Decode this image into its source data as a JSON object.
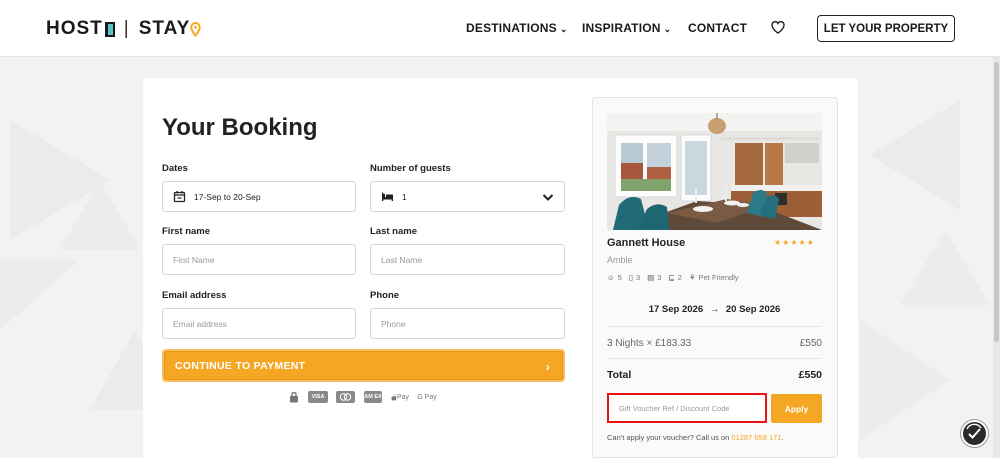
{
  "header": {
    "logo_host": "HOST",
    "logo_stay": "STAY",
    "nav_destinations": "DESTINATIONS",
    "nav_inspiration": "INSPIRATION",
    "nav_contact": "CONTACT",
    "let_property": "LET YOUR PROPERTY",
    "icons": [
      "heart-icon",
      "chevron-down-icon",
      "map-pin-icon"
    ]
  },
  "booking": {
    "title": "Your Booking",
    "dates_label": "Dates",
    "dates_value": "17-Sep to 20-Sep",
    "guests_label": "Number of guests",
    "guests_value": "1",
    "first_name_label": "First name",
    "first_name_placeholder": "First Name",
    "last_name_label": "Last name",
    "last_name_placeholder": "Last Name",
    "email_label": "Email address",
    "email_placeholder": "Email address",
    "phone_label": "Phone",
    "phone_placeholder": "Phone",
    "continue_label": "CONTINUE TO PAYMENT",
    "payment_icons": [
      "lock-icon",
      "visa-icon",
      "mastercard-icon",
      "amex-icon",
      "apple-pay-icon",
      "google-pay-icon"
    ],
    "visa": "VISA",
    "amex": "AM EX",
    "apple_pay": "Pay",
    "google_pay": "G Pay"
  },
  "property": {
    "name": "Gannett House",
    "stars": "★★★★★",
    "rating_stars": 5,
    "location": "Amble",
    "guests": "5",
    "bedrooms": "3",
    "beds": "3",
    "bathrooms": "2",
    "pet": "Pet Friendly",
    "check_in": "17 Sep 2026",
    "check_out": "20 Sep 2026",
    "arrow": "→",
    "nights_text": "3 Nights × £183.33",
    "nights_price": "£550",
    "total_label": "Total",
    "total_price": "£550",
    "voucher_placeholder": "Gift Voucher Ref / Discount Code",
    "apply_label": "Apply",
    "voucher_note": "Can't apply your voucher? Call us on ",
    "voucher_phone": "01287 658 171",
    "voucher_note_end": "."
  },
  "colors": {
    "accent": "#f5a623",
    "highlight": "#e8141a",
    "teal": "#5cc3c7"
  }
}
